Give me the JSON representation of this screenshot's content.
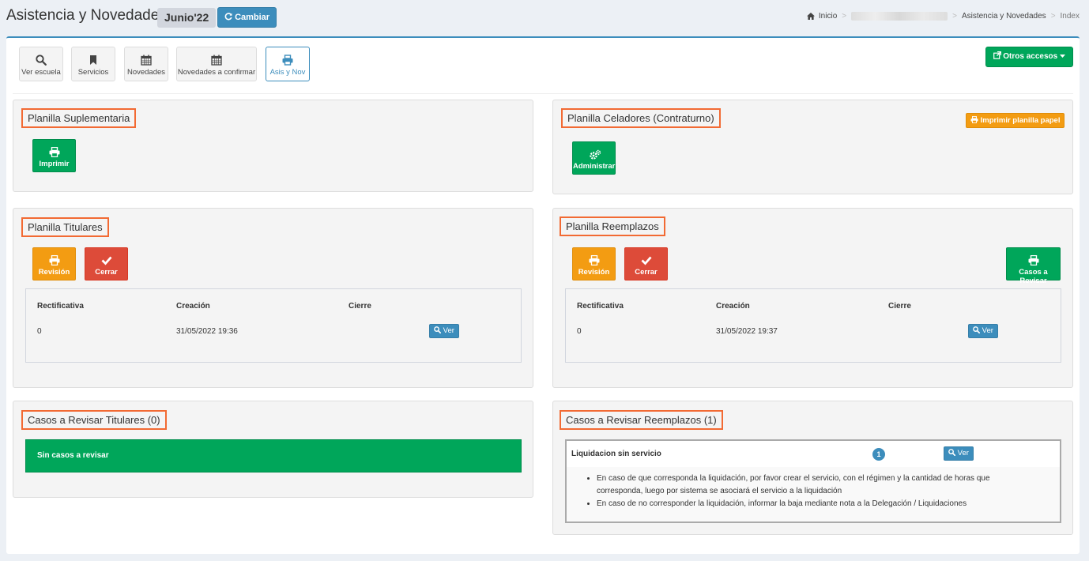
{
  "header": {
    "title": "Asistencia y Novedades",
    "month": "Junio'22",
    "change_label": "Cambiar",
    "breadcrumb": {
      "home": "Inicio",
      "section": "Asistencia y Novedades",
      "current": "Index"
    }
  },
  "toolbar": {
    "items": [
      {
        "label": "Ver escuela",
        "icon": "search-icon"
      },
      {
        "label": "Servicios",
        "icon": "bookmark-icon"
      },
      {
        "label": "Novedades",
        "icon": "calendar-icon"
      },
      {
        "label": "Novedades a confirmar",
        "icon": "calendar-icon"
      },
      {
        "label": "Asis y Nov",
        "icon": "print-icon"
      }
    ],
    "other_access_label": "Otros accesos"
  },
  "panels": {
    "suplementaria": {
      "title": "Planilla Suplementaria",
      "print_label": "Imprimir"
    },
    "celadores": {
      "title": "Planilla Celadores (Contraturno)",
      "print_paper_label": "Imprimir planilla papel",
      "admin_label": "Administrar"
    },
    "titulares": {
      "title": "Planilla Titulares",
      "review_label": "Revisión",
      "close_label": "Cerrar",
      "table": {
        "headers": [
          "Rectificativa",
          "Creación",
          "Cierre"
        ],
        "rows": [
          {
            "rectificativa": "0",
            "creacion": "31/05/2022 19:36",
            "cierre": "",
            "action": "Ver"
          }
        ]
      }
    },
    "reemplazos": {
      "title": "Planilla Reemplazos",
      "review_label": "Revisión",
      "close_label": "Cerrar",
      "cases_label": "Casos a Revisar",
      "table": {
        "headers": [
          "Rectificativa",
          "Creación",
          "Cierre"
        ],
        "rows": [
          {
            "rectificativa": "0",
            "creacion": "31/05/2022 19:37",
            "cierre": "",
            "action": "Ver"
          }
        ]
      }
    },
    "casos_titulares": {
      "title": "Casos a Revisar Titulares (0)",
      "empty_message": "Sin casos a revisar"
    },
    "casos_reemplazos": {
      "title": "Casos a Revisar Reemplazos (1)",
      "case": {
        "label": "Liquidacion sin servicio",
        "count": "1",
        "action": "Ver",
        "notes": [
          "En caso de que corresponda la liquidación, por favor crear el servicio, con el régimen y la cantidad de horas que corresponda, luego por sistema se asociará el servicio a la liquidación",
          "En caso de no corresponder la liquidación, informar la baja mediante nota a la Delegación / Liquidaciones"
        ]
      }
    }
  },
  "colors": {
    "primary": "#3c8dbc",
    "success": "#00a65a",
    "warning": "#f39c12",
    "danger": "#dd4b39",
    "highlight": "#f26a33"
  }
}
